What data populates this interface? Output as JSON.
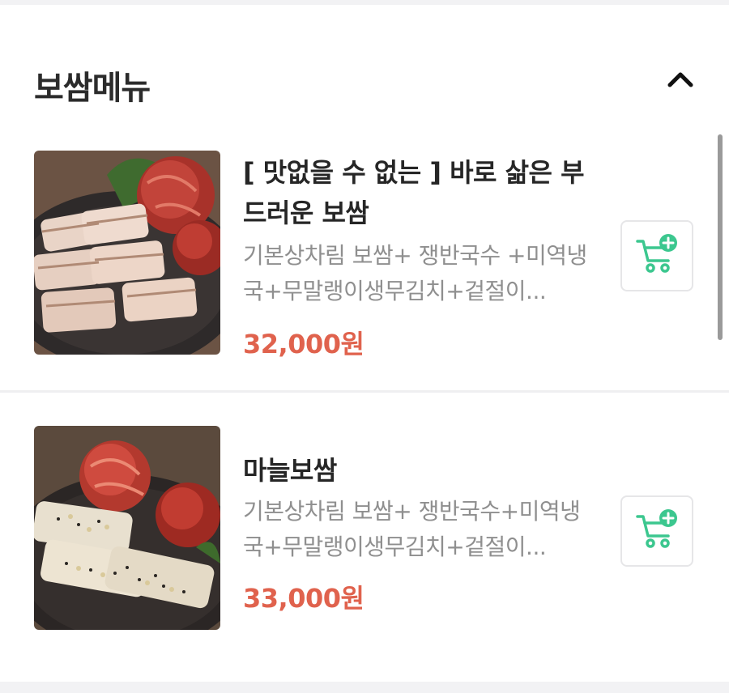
{
  "section": {
    "title": "보쌈메뉴"
  },
  "menu_items": [
    {
      "name": "[ 맛없을 수 없는 ] 바로 삶은 부드러운 보쌈",
      "description": "기본상차림 보쌈+ 쟁반국수 +미역냉국+무말랭이생무김치+겉절이...",
      "price": "32,000원"
    },
    {
      "name": "마늘보쌈",
      "description": "기본상차림 보쌈+ 쟁반국수+미역냉국+무말랭이생무김치+겉절이...",
      "price": "33,000원"
    }
  ],
  "icons": {
    "collapse": "chevron-up-icon",
    "cart": "add-to-cart-icon"
  },
  "colors": {
    "price": "#e0624d",
    "cart_accent": "#3cc78f",
    "title": "#2b2b2b",
    "description": "#8f8f8f"
  }
}
